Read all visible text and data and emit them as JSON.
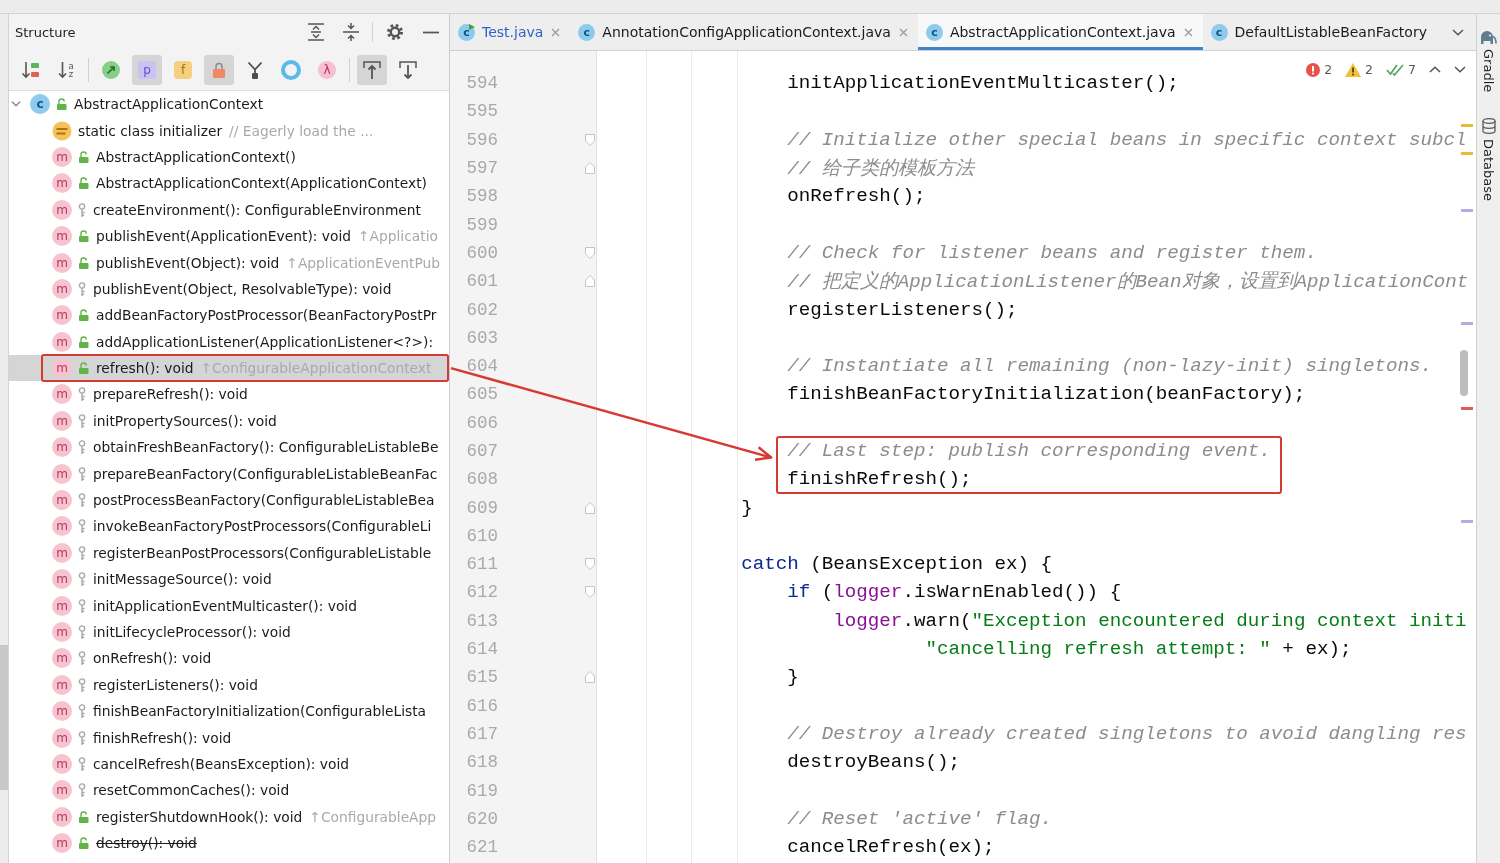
{
  "structure": {
    "title": "Structure",
    "actions": [
      [
        {
          "kind": "expand-all"
        },
        {
          "kind": "collapse-all"
        }
      ],
      [
        {
          "kind": "settings"
        },
        {
          "kind": "minimize"
        }
      ]
    ],
    "toolbar_groups": [
      [
        {
          "kind": "sort-visibility",
          "on": false
        },
        {
          "kind": "sort-alpha",
          "glyph": "az",
          "on": false
        }
      ],
      [
        {
          "kind": "inherited",
          "on": false
        },
        {
          "kind": "properties",
          "glyph": "p",
          "on": true
        },
        {
          "kind": "fields",
          "glyph": "f",
          "on": false
        },
        {
          "kind": "non-public",
          "on": true
        },
        {
          "kind": "tree-style",
          "on": false
        },
        {
          "kind": "anonymous",
          "on": false
        },
        {
          "kind": "lambdas",
          "glyph": "λ",
          "on": false
        }
      ],
      [
        {
          "kind": "scroll-to-source",
          "on": true
        },
        {
          "kind": "scroll-from-source",
          "on": false
        }
      ]
    ],
    "tree": [
      {
        "kind": "class",
        "badge": "c",
        "public": true,
        "label": "AbstractApplicationContext",
        "expanded": true,
        "selected": false,
        "annotated": false,
        "children": [
          {
            "kind": "initializer",
            "label": "static class initializer",
            "comment": "// Eagerly load the ...",
            "selected": false,
            "annotated": false
          },
          {
            "kind": "method",
            "badge": "m",
            "public": true,
            "label": "AbstractApplicationContext()",
            "deprecated": false,
            "selected": false,
            "annotated": false
          },
          {
            "kind": "method",
            "badge": "m",
            "public": true,
            "label": "AbstractApplicationContext(ApplicationContext)",
            "deprecated": false,
            "selected": false,
            "annotated": false
          },
          {
            "kind": "method",
            "badge": "m",
            "public": false,
            "label": "createEnvironment(): ConfigurableEnvironment",
            "deprecated": false,
            "selected": false,
            "annotated": false
          },
          {
            "kind": "method",
            "badge": "m",
            "public": true,
            "label": "publishEvent(ApplicationEvent): void",
            "origin": "↑Applicatio",
            "deprecated": false,
            "selected": false,
            "annotated": false
          },
          {
            "kind": "method",
            "badge": "m",
            "public": true,
            "label": "publishEvent(Object): void",
            "origin": "↑ApplicationEventPub",
            "deprecated": false,
            "selected": false,
            "annotated": false
          },
          {
            "kind": "method",
            "badge": "m",
            "public": false,
            "label": "publishEvent(Object, ResolvableType): void",
            "deprecated": false,
            "selected": false,
            "annotated": false
          },
          {
            "kind": "method",
            "badge": "m",
            "public": true,
            "label": "addBeanFactoryPostProcessor(BeanFactoryPostPr",
            "deprecated": false,
            "selected": false,
            "annotated": false
          },
          {
            "kind": "method",
            "badge": "m",
            "public": true,
            "label": "addApplicationListener(ApplicationListener<?>):",
            "deprecated": false,
            "selected": false,
            "annotated": false
          },
          {
            "kind": "method",
            "badge": "m",
            "public": true,
            "label": "refresh(): void",
            "origin": "↑ConfigurableApplicationContext",
            "deprecated": false,
            "selected": true,
            "annotated": true
          },
          {
            "kind": "method",
            "badge": "m",
            "public": false,
            "label": "prepareRefresh(): void",
            "deprecated": false,
            "selected": false,
            "annotated": false
          },
          {
            "kind": "method",
            "badge": "m",
            "public": false,
            "label": "initPropertySources(): void",
            "deprecated": false,
            "selected": false,
            "annotated": false
          },
          {
            "kind": "method",
            "badge": "m",
            "public": false,
            "label": "obtainFreshBeanFactory(): ConfigurableListableBe",
            "deprecated": false,
            "selected": false,
            "annotated": false
          },
          {
            "kind": "method",
            "badge": "m",
            "public": false,
            "label": "prepareBeanFactory(ConfigurableListableBeanFac",
            "deprecated": false,
            "selected": false,
            "annotated": false
          },
          {
            "kind": "method",
            "badge": "m",
            "public": false,
            "label": "postProcessBeanFactory(ConfigurableListableBea",
            "deprecated": false,
            "selected": false,
            "annotated": false
          },
          {
            "kind": "method",
            "badge": "m",
            "public": false,
            "label": "invokeBeanFactoryPostProcessors(ConfigurableLi",
            "deprecated": false,
            "selected": false,
            "annotated": false
          },
          {
            "kind": "method",
            "badge": "m",
            "public": false,
            "label": "registerBeanPostProcessors(ConfigurableListable",
            "deprecated": false,
            "selected": false,
            "annotated": false
          },
          {
            "kind": "method",
            "badge": "m",
            "public": false,
            "label": "initMessageSource(): void",
            "deprecated": false,
            "selected": false,
            "annotated": false
          },
          {
            "kind": "method",
            "badge": "m",
            "public": false,
            "label": "initApplicationEventMulticaster(): void",
            "deprecated": false,
            "selected": false,
            "annotated": false
          },
          {
            "kind": "method",
            "badge": "m",
            "public": false,
            "label": "initLifecycleProcessor(): void",
            "deprecated": false,
            "selected": false,
            "annotated": false
          },
          {
            "kind": "method",
            "badge": "m",
            "public": false,
            "label": "onRefresh(): void",
            "deprecated": false,
            "selected": false,
            "annotated": false
          },
          {
            "kind": "method",
            "badge": "m",
            "public": false,
            "label": "registerListeners(): void",
            "deprecated": false,
            "selected": false,
            "annotated": false
          },
          {
            "kind": "method",
            "badge": "m",
            "public": false,
            "label": "finishBeanFactoryInitialization(ConfigurableLista",
            "deprecated": false,
            "selected": false,
            "annotated": false
          },
          {
            "kind": "method",
            "badge": "m",
            "public": false,
            "label": "finishRefresh(): void",
            "deprecated": false,
            "selected": false,
            "annotated": false
          },
          {
            "kind": "method",
            "badge": "m",
            "public": false,
            "label": "cancelRefresh(BeansException): void",
            "deprecated": false,
            "selected": false,
            "annotated": false
          },
          {
            "kind": "method",
            "badge": "m",
            "public": false,
            "label": "resetCommonCaches(): void",
            "deprecated": false,
            "selected": false,
            "annotated": false
          },
          {
            "kind": "method",
            "badge": "m",
            "public": true,
            "label": "registerShutdownHook(): void",
            "origin": "↑ConfigurableApp",
            "deprecated": false,
            "selected": false,
            "annotated": false
          },
          {
            "kind": "method",
            "badge": "m",
            "public": true,
            "label": "destroy(): void",
            "deprecated": true,
            "selected": false,
            "annotated": false
          }
        ]
      }
    ]
  },
  "editor": {
    "tabs": [
      {
        "label": "Test.java",
        "badge": "c",
        "runnable": true,
        "modified": true,
        "closable": true,
        "selected": false
      },
      {
        "label": "AnnotationConfigApplicationContext.java",
        "badge": "c",
        "runnable": false,
        "modified": false,
        "closable": true,
        "selected": false
      },
      {
        "label": "AbstractApplicationContext.java",
        "badge": "c",
        "runnable": false,
        "modified": false,
        "closable": true,
        "selected": true
      },
      {
        "label": "DefaultListableBeanFactory",
        "badge": "c",
        "runnable": false,
        "modified": false,
        "closable": false,
        "selected": false
      }
    ],
    "inspections": [
      {
        "kind": "error",
        "count": "2"
      },
      {
        "kind": "warning",
        "count": "2"
      },
      {
        "kind": "typo",
        "count": "7"
      }
    ],
    "lines": [
      {
        "number": "594",
        "annotated": false,
        "tokens": [
          {
            "text": "                initApplicationEventMulticaster();",
            "kind": "plain"
          }
        ]
      },
      {
        "number": "595",
        "annotated": false
      },
      {
        "number": "596",
        "annotated": false,
        "fold": {
          "kind": "start"
        },
        "stripe": {
          "color": "#e8b93a"
        },
        "tokens": [
          {
            "text": "                // Initialize other special beans in specific context subcl",
            "kind": "comment"
          }
        ]
      },
      {
        "number": "597",
        "annotated": false,
        "fold": {
          "kind": "end"
        },
        "stripe": {
          "color": "#e8b93a"
        },
        "tokens": [
          {
            "text": "                // 给子类的模板方法",
            "kind": "comment"
          }
        ]
      },
      {
        "number": "598",
        "annotated": false,
        "tokens": [
          {
            "text": "                onRefresh();",
            "kind": "plain"
          }
        ]
      },
      {
        "number": "599",
        "annotated": false,
        "stripe": {
          "color": "#b9a8e6"
        }
      },
      {
        "number": "600",
        "annotated": false,
        "fold": {
          "kind": "start"
        },
        "tokens": [
          {
            "text": "                // Check for listener beans and register them.",
            "kind": "comment"
          }
        ]
      },
      {
        "number": "601",
        "annotated": false,
        "fold": {
          "kind": "end"
        },
        "tokens": [
          {
            "text": "                // 把定义的ApplicationListener的Bean对象，设置到ApplicationCont",
            "kind": "comment"
          }
        ]
      },
      {
        "number": "602",
        "annotated": false,
        "tokens": [
          {
            "text": "                registerListeners();",
            "kind": "plain"
          }
        ]
      },
      {
        "number": "603",
        "annotated": false,
        "stripe": {
          "color": "#b9a8e6"
        }
      },
      {
        "number": "604",
        "annotated": false,
        "tokens": [
          {
            "text": "                // Instantiate all remaining (non-lazy-init) singletons.",
            "kind": "comment"
          }
        ]
      },
      {
        "number": "605",
        "annotated": false,
        "tokens": [
          {
            "text": "                finishBeanFactoryInitialization(beanFactory);",
            "kind": "plain"
          }
        ]
      },
      {
        "number": "606",
        "annotated": false,
        "stripe": {
          "color": "#e0585a"
        }
      },
      {
        "number": "607",
        "annotated": true,
        "tokens": [
          {
            "text": "                // Last step: publish corresponding event.",
            "kind": "comment"
          }
        ]
      },
      {
        "number": "608",
        "annotated": true,
        "tokens": [
          {
            "text": "                finishRefresh();",
            "kind": "plain"
          }
        ]
      },
      {
        "number": "609",
        "annotated": false,
        "fold": {
          "kind": "end"
        },
        "tokens": [
          {
            "text": "            }",
            "kind": "plain"
          }
        ]
      },
      {
        "number": "610",
        "annotated": false,
        "stripe": {
          "color": "#b9a8e6"
        }
      },
      {
        "number": "611",
        "annotated": false,
        "fold": {
          "kind": "start"
        },
        "tokens": [
          {
            "text": "            catch",
            "kind": "keyword"
          },
          {
            "text": " (BeansException ex) {",
            "kind": "plain"
          }
        ]
      },
      {
        "number": "612",
        "annotated": false,
        "fold": {
          "kind": "start"
        },
        "tokens": [
          {
            "text": "                if",
            "kind": "keyword"
          },
          {
            "text": " (",
            "kind": "plain"
          },
          {
            "text": "logger",
            "kind": "field"
          },
          {
            "text": ".isWarnEnabled()) {",
            "kind": "plain"
          }
        ]
      },
      {
        "number": "613",
        "annotated": false,
        "tokens": [
          {
            "text": "                    logger",
            "kind": "field"
          },
          {
            "text": ".warn(",
            "kind": "plain"
          },
          {
            "text": "\"Exception encountered during context initi",
            "kind": "string"
          }
        ]
      },
      {
        "number": "614",
        "annotated": false,
        "tokens": [
          {
            "text": "                            \"cancelling refresh attempt: \"",
            "kind": "string"
          },
          {
            "text": " + ex);",
            "kind": "plain"
          }
        ]
      },
      {
        "number": "615",
        "annotated": false,
        "fold": {
          "kind": "end"
        },
        "tokens": [
          {
            "text": "                }",
            "kind": "plain"
          }
        ]
      },
      {
        "number": "616",
        "annotated": false
      },
      {
        "number": "617",
        "annotated": false,
        "tokens": [
          {
            "text": "                // Destroy already created singletons to avoid dangling res",
            "kind": "comment"
          }
        ]
      },
      {
        "number": "618",
        "annotated": false,
        "tokens": [
          {
            "text": "                destroyBeans();",
            "kind": "plain"
          }
        ]
      },
      {
        "number": "619",
        "annotated": false
      },
      {
        "number": "620",
        "annotated": false,
        "tokens": [
          {
            "text": "                // Reset 'active' flag.",
            "kind": "comment"
          }
        ]
      },
      {
        "number": "621",
        "annotated": false,
        "tokens": [
          {
            "text": "                cancelRefresh(ex);",
            "kind": "plain"
          }
        ]
      }
    ]
  },
  "tool_windows": [
    {
      "kind": "gradle",
      "label": "Gradle"
    },
    {
      "kind": "database",
      "label": "Database"
    }
  ]
}
